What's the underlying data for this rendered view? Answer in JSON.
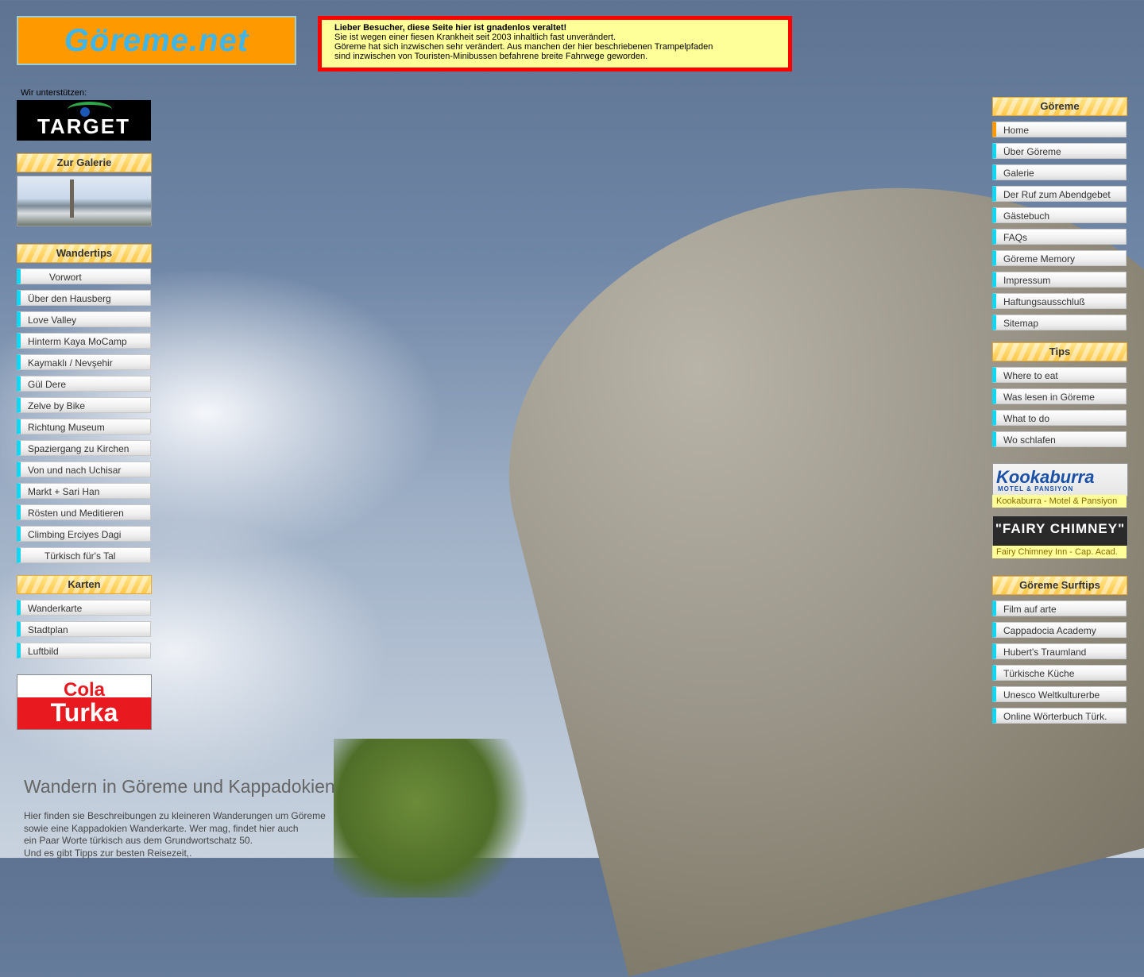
{
  "site": {
    "logo_text": "Göreme.net"
  },
  "notice": {
    "line1": "Lieber Besucher, diese Seite hier ist gnadenlos veraltet!",
    "line2": "Sie ist wegen einer fiesen Krankheit seit 2003 inhaltlich fast unverändert.",
    "line3": "Göreme hat sich inzwischen sehr verändert. Aus manchen der hier beschriebenen Trampelpfaden",
    "line4": "sind inzwischen von Touristen-Minibussen befahrene breite Fahrwege geworden."
  },
  "left": {
    "support_label": "Wir unterstützen:",
    "target_logo": "TARGET",
    "gallery_head": "Zur Galerie",
    "wander_head": "Wandertips",
    "wander_items": [
      "Vorwort",
      "Über den Hausberg",
      "Love Valley",
      "Hinterm Kaya MoCamp",
      "Kaymaklı / Nevşehir",
      "Gül Dere",
      "Zelve by Bike",
      "Richtung Museum",
      "Spaziergang zu Kirchen",
      "Von und nach Uchisar",
      "Markt + Sari Han",
      "Rösten und Meditieren",
      "Climbing Erciyes Dagi",
      "Türkisch für's Tal"
    ],
    "karten_head": "Karten",
    "karten_items": [
      "Wanderkarte",
      "Stadtplan",
      "Luftbild"
    ],
    "cola_top": "Cola",
    "cola_bottom": "Turka"
  },
  "right": {
    "goreme_head": "Göreme",
    "goreme_items": [
      "Home",
      "Über Göreme",
      "Galerie",
      "Der Ruf zum Abendgebet",
      "Gästebuch",
      "FAQs",
      "Göreme Memory",
      "Impressum",
      "Haftungsausschluß",
      "Sitemap"
    ],
    "tips_head": "Tips",
    "tips_items": [
      "Where to eat",
      "Was lesen in Göreme",
      "What to do",
      "Wo schlafen"
    ],
    "kookaburra_logo": "Kookaburra",
    "kookaburra_sub": "MOTEL & PANSIYON",
    "kookaburra_caption": "Kookaburra - Motel & Pansiyon",
    "fairy_logo": "\"FAIRY CHIMNEY\"",
    "fairy_caption": "Fairy Chimney Inn - Cap. Acad.",
    "surf_head": "Göreme Surftips",
    "surf_items": [
      "Film auf arte",
      "Cappadocia Academy",
      "Hubert's Traumland",
      "Türkische Küche",
      "Unesco Weltkulturerbe",
      "Online Wörterbuch Türk."
    ]
  },
  "main": {
    "title": "Wandern in Göreme und Kappadokien",
    "intro_1": "Hier finden sie Beschreibungen zu kleineren Wanderungen um Göreme",
    "intro_2": "sowie eine Kappadokien Wanderkarte. Wer mag, findet hier auch",
    "intro_3": "ein Paar Worte türkisch aus dem Grundwortschatz 50.",
    "intro_4": "Und es gibt Tipps zur besten Reisezeit,."
  },
  "colors": {
    "accent_orange": "#ff9900",
    "menu_marker": "#11d6f2",
    "notice_border": "#ff0000"
  }
}
